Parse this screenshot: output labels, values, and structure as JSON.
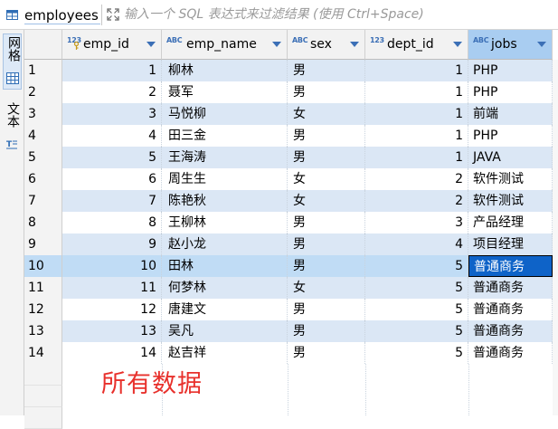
{
  "toolbar": {
    "table_name": "employees",
    "filter_placeholder": "输入一个 SQL 表达式来过滤结果 (使用 Ctrl+Space)"
  },
  "side_tabs": {
    "grid_label": "网格",
    "text_label": "文本"
  },
  "columns": [
    {
      "type_badge": "123",
      "name": "emp_id"
    },
    {
      "type_badge": "ABC",
      "name": "emp_name"
    },
    {
      "type_badge": "ABC",
      "name": "sex"
    },
    {
      "type_badge": "123",
      "name": "dept_id"
    },
    {
      "type_badge": "ABC",
      "name": "jobs"
    }
  ],
  "rows": [
    {
      "rownum": "1",
      "emp_id": "1",
      "emp_name": "柳林",
      "sex": "男",
      "dept_id": "1",
      "jobs": "PHP"
    },
    {
      "rownum": "2",
      "emp_id": "2",
      "emp_name": "聂军",
      "sex": "男",
      "dept_id": "1",
      "jobs": "PHP"
    },
    {
      "rownum": "3",
      "emp_id": "3",
      "emp_name": "马悦柳",
      "sex": "女",
      "dept_id": "1",
      "jobs": "前端"
    },
    {
      "rownum": "4",
      "emp_id": "4",
      "emp_name": "田三金",
      "sex": "男",
      "dept_id": "1",
      "jobs": "PHP"
    },
    {
      "rownum": "5",
      "emp_id": "5",
      "emp_name": "王海涛",
      "sex": "男",
      "dept_id": "1",
      "jobs": "JAVA"
    },
    {
      "rownum": "6",
      "emp_id": "6",
      "emp_name": "周生生",
      "sex": "女",
      "dept_id": "2",
      "jobs": "软件测试"
    },
    {
      "rownum": "7",
      "emp_id": "7",
      "emp_name": "陈艳秋",
      "sex": "女",
      "dept_id": "2",
      "jobs": "软件测试"
    },
    {
      "rownum": "8",
      "emp_id": "8",
      "emp_name": "王柳林",
      "sex": "男",
      "dept_id": "3",
      "jobs": "产品经理"
    },
    {
      "rownum": "9",
      "emp_id": "9",
      "emp_name": "赵小龙",
      "sex": "男",
      "dept_id": "4",
      "jobs": "项目经理"
    },
    {
      "rownum": "10",
      "emp_id": "10",
      "emp_name": "田林",
      "sex": "男",
      "dept_id": "5",
      "jobs": "普通商务"
    },
    {
      "rownum": "11",
      "emp_id": "11",
      "emp_name": "何梦林",
      "sex": "女",
      "dept_id": "5",
      "jobs": "普通商务"
    },
    {
      "rownum": "12",
      "emp_id": "12",
      "emp_name": "唐建文",
      "sex": "男",
      "dept_id": "5",
      "jobs": "普通商务"
    },
    {
      "rownum": "13",
      "emp_id": "13",
      "emp_name": "吴凡",
      "sex": "男",
      "dept_id": "5",
      "jobs": "普通商务"
    },
    {
      "rownum": "14",
      "emp_id": "14",
      "emp_name": "赵吉祥",
      "sex": "男",
      "dept_id": "5",
      "jobs": "普通商务"
    }
  ],
  "selected_row": "10",
  "annotation": "所有数据",
  "colors": {
    "accent": "#0e63c8",
    "alt_row": "#dbe7f5",
    "annotation": "#e8302b"
  }
}
